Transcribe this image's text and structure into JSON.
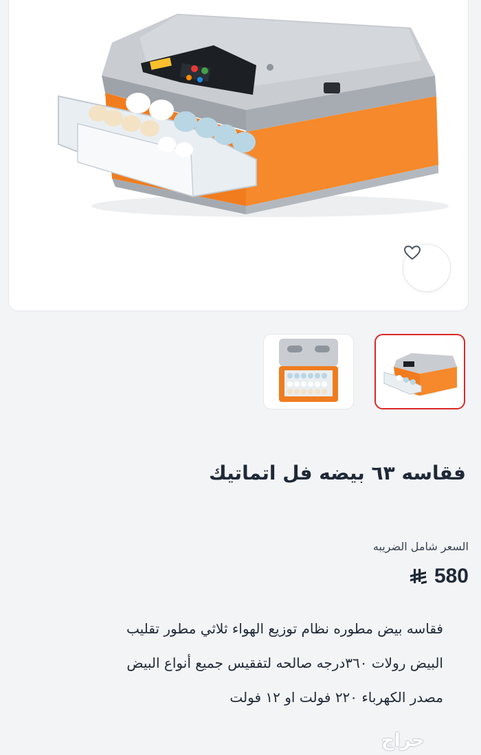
{
  "product": {
    "title": "فقاسه ٦٣ بيضه فل اتماتيك",
    "price_label": "السعر شامل الضريبه",
    "price_value": "580",
    "currency": "riyal-symbol",
    "description_lines": [
      "فقاسه بيض مطوره نظام توزيع الهواء ثلاثي مطور تقليب",
      "البيض رولات ٣٦٠درجه صالحه لتفقيس جميع أنواع البيض",
      "مصدر الكهرباء ٢٢٠ فولت او ١٢ فولت"
    ]
  },
  "gallery": {
    "main_image": "egg-incubator-orange-grey",
    "thumbnails": [
      {
        "name": "incubator-front",
        "selected": true
      },
      {
        "name": "incubator-open-top",
        "selected": false
      }
    ],
    "selected_border_color": "#dc2626"
  },
  "actions": {
    "favorite_icon": "heart-outline-icon"
  },
  "watermark": "حراج",
  "colors": {
    "accent_orange": "#f07c1e",
    "body_grey": "#b8bcc2",
    "background": "#f3f4f6"
  }
}
